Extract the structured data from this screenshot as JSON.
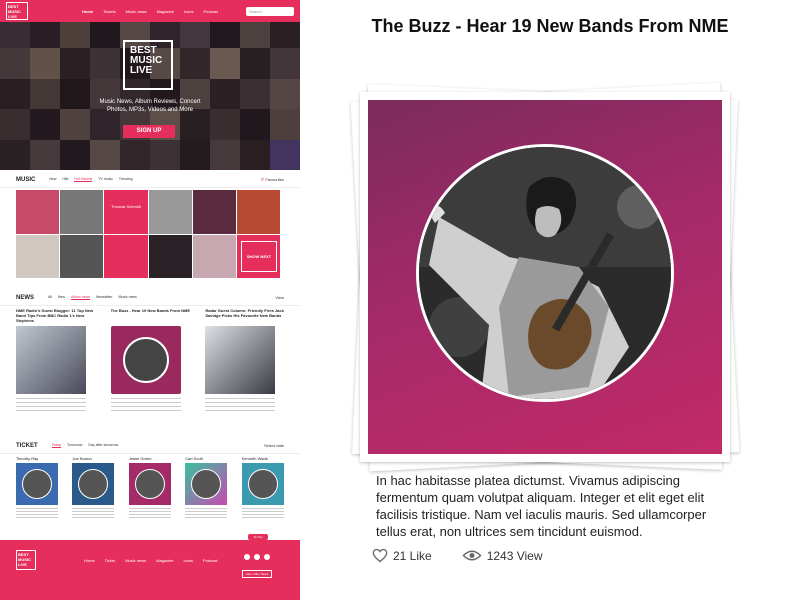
{
  "site": {
    "logo": "BEST MUSIC LIVE",
    "nav": [
      "Home",
      "Tickets",
      "Music news",
      "Magazine",
      "Icons",
      "Podcast"
    ],
    "search_placeholder": "Search",
    "hero_logo": "BEST MUSIC LIVE",
    "hero_text": "Music News, Album Reviews, Concert Photos, MP3s, Videos and More",
    "signup": "SIGN UP",
    "music": {
      "title": "MUSIC",
      "tabs": [
        "New",
        "Hits",
        "Hot Albums",
        "TV music",
        "Trending"
      ],
      "favourites": "Favourites",
      "mid_card": "Thomas Schmidt",
      "show_next": "SHOW NEXT"
    },
    "news": {
      "title": "NEWS",
      "tabs": [
        "All",
        "New",
        "Album news",
        "Newsletter",
        "Music news"
      ],
      "view": "View",
      "items": [
        {
          "title": "NME Radio's Guest Blogger: 11 Top New Band Tips From BBC Radio 1's New Stephens"
        },
        {
          "title": "The Buzz - Hear 19 New Bands From NME"
        },
        {
          "title": "Radar Guest Column: Friendly Fires Jack Savidge Picks His Favourite New Bands"
        }
      ]
    },
    "ticket": {
      "title": "TICKET",
      "tabs": [
        "Today",
        "Tomorrow",
        "Day after tomorrow"
      ],
      "select": "Select date",
      "artists": [
        "Timothy Ray",
        "Joe Burton",
        "Jesse Green",
        "Carl Scott",
        "Kenneth Wade"
      ]
    },
    "footer": {
      "logo": "BEST MUSIC LIVE",
      "nav": [
        "Home",
        "Ticket",
        "Music news",
        "Magazine",
        "Icons",
        "Podcast"
      ],
      "button": "Ask / Offer News",
      "top": "To Top"
    }
  },
  "article": {
    "title": "The Buzz - Hear 19 New Bands From NME",
    "body": "In hac habitasse platea dictumst. Vivamus adipiscing fermentum quam volutpat aliquam. Integer et elit eget elit facilisis tristique. Nam vel iaculis mauris. Sed ullamcorper tellus erat, non ultrices sem tincidunt euismod.",
    "likes": "21 Like",
    "views": "1243 View"
  },
  "colors": {
    "accent": "#e62e5c",
    "frame": "#a42a6a"
  }
}
